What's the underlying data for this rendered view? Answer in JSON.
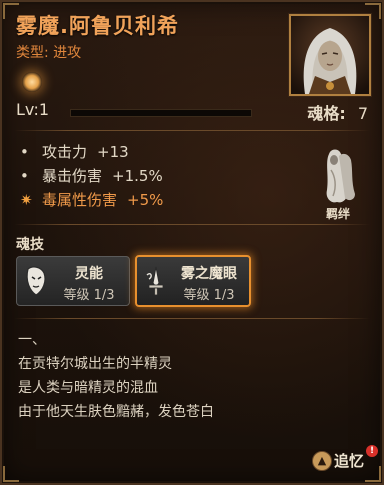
{
  "character": {
    "name": "雾魔.阿鲁贝利希",
    "type_line": "类型: 进攻"
  },
  "level": {
    "label": "Lv:1",
    "progress": 0.0
  },
  "soul_grid": {
    "label": "魂格:",
    "value": "7"
  },
  "stats": [
    {
      "bullet": "•",
      "name": "攻击力",
      "value": "+13",
      "highlight": false
    },
    {
      "bullet": "•",
      "name": "暴击伤害",
      "value": "+1.5%",
      "highlight": false
    },
    {
      "bullet": "✷",
      "name": "毒属性伤害",
      "value": "+5%",
      "highlight": true
    }
  ],
  "bond": {
    "label": "羁绊",
    "icon": "ghost-figure-icon"
  },
  "skills": {
    "heading": "魂技",
    "items": [
      {
        "name": "灵能",
        "level": "等级 1/3",
        "icon": "mask-icon",
        "selected": false
      },
      {
        "name": "雾之魔眼",
        "level": "等级 1/3",
        "icon": "dagger-icon",
        "selected": true
      }
    ]
  },
  "story": {
    "lines": [
      "一、",
      "在贡特尔城出生的半精灵",
      "是人类与暗精灵的混血",
      "由于他天生肤色黯赭，发色苍白"
    ]
  },
  "recall": {
    "label": "追忆",
    "badge": "!",
    "icon": "recall-icon"
  },
  "colors": {
    "title": "#f1a35a",
    "type": "#e0863c",
    "accent": "#e8902e",
    "highlight_stat": "#f09a4a",
    "badge": "#d8312a"
  }
}
